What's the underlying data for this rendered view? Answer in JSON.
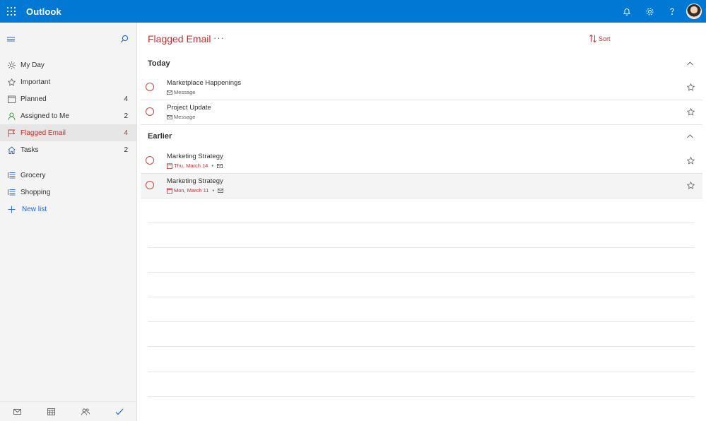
{
  "app": {
    "title": "Outlook"
  },
  "colors": {
    "brand": "#0078d4",
    "accent": "#c53030",
    "link": "#2564cf"
  },
  "sidebar": {
    "items": [
      {
        "label": "My Day",
        "count": "",
        "icon": "sun-icon"
      },
      {
        "label": "Important",
        "count": "",
        "icon": "star-icon"
      },
      {
        "label": "Planned",
        "count": "4",
        "icon": "calendar-icon"
      },
      {
        "label": "Assigned to Me",
        "count": "2",
        "icon": "person-icon"
      },
      {
        "label": "Flagged Email",
        "count": "4",
        "icon": "flag-icon",
        "active": true
      },
      {
        "label": "Tasks",
        "count": "2",
        "icon": "home-icon"
      }
    ],
    "lists": [
      {
        "label": "Grocery",
        "icon": "list-icon"
      },
      {
        "label": "Shopping",
        "icon": "list-icon"
      }
    ],
    "new_list_label": "New list"
  },
  "main": {
    "title": "Flagged Email",
    "more_label": "···",
    "sort_label": "Sort",
    "groups": [
      {
        "title": "Today",
        "tasks": [
          {
            "title": "Marketplace Happenings",
            "meta": "Message"
          },
          {
            "title": "Project Update",
            "meta": "Message"
          }
        ]
      },
      {
        "title": "Earlier",
        "tasks": [
          {
            "title": "Marketing Strategy",
            "due": "Thu, March 14"
          },
          {
            "title": "Marketing Strategy",
            "due": "Mon, March 11"
          }
        ]
      }
    ]
  }
}
